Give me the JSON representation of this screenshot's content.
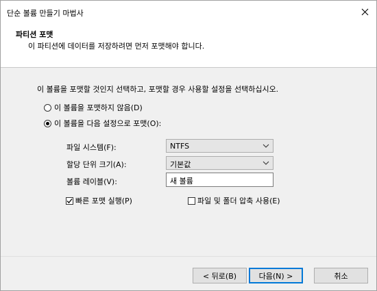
{
  "window": {
    "title": "단순 볼륨 만들기 마법사"
  },
  "header": {
    "title": "파티션 포맷",
    "description": "이 파티션에 데이터를 저장하려면 먼저 포맷해야 합니다."
  },
  "main": {
    "instruction": "이 볼륨을 포맷할 것인지 선택하고, 포맷할 경우 사용할 설정을 선택하십시오.",
    "radio_no_format": {
      "label": "이 볼륨을 포맷하지 않음(D)",
      "checked": false
    },
    "radio_format": {
      "label": "이 볼륨을 다음 설정으로 포맷(O):",
      "checked": true
    },
    "file_system": {
      "label": "파일 시스템(F):",
      "value": "NTFS"
    },
    "allocation_unit": {
      "label": "할당 단위 크기(A):",
      "value": "기본값"
    },
    "volume_label": {
      "label": "볼륨 레이블(V):",
      "value": "새 볼륨"
    },
    "quick_format": {
      "label": "빠른 포맷 실행(P)",
      "checked": true
    },
    "compression": {
      "label": "파일 및 폴더 압축 사용(E)",
      "checked": false
    }
  },
  "footer": {
    "back_label": "< 뒤로(B)",
    "next_label": "다음(N) >",
    "cancel_label": "취소"
  },
  "colors": {
    "accent": "#0078d7"
  }
}
